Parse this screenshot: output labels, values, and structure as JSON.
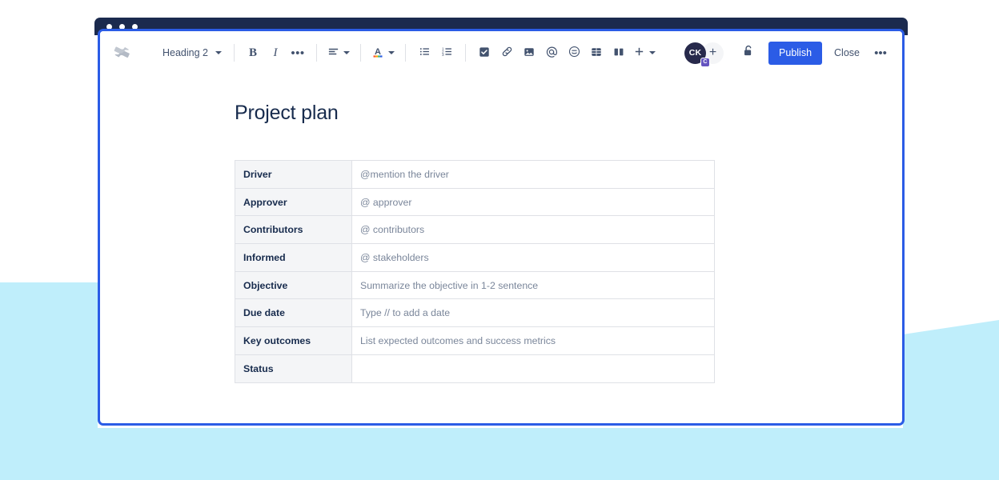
{
  "window": {
    "traffic_lights": [
      "dot-1",
      "dot-2",
      "dot-3"
    ]
  },
  "toolbar": {
    "app_logo_name": "confluence-logo-icon",
    "heading_select": {
      "label": "Heading 2",
      "icon": "chevron-down-icon"
    },
    "format_buttons": [
      {
        "name": "bold-button",
        "label": "B",
        "icon": "bold-icon"
      },
      {
        "name": "italic-button",
        "label": "I",
        "icon": "italic-icon"
      },
      {
        "name": "more-formatting-button",
        "label": "•••",
        "icon": "ellipsis-icon"
      }
    ],
    "align_button": {
      "name": "text-align-button",
      "icon": "align-left-icon"
    },
    "text-color_button": {
      "name": "text-color-button",
      "label": "A",
      "icon": "text-color-icon"
    },
    "list_buttons": [
      {
        "name": "bullet-list-button",
        "icon": "bullet-list-icon"
      },
      {
        "name": "numbered-list-button",
        "icon": "numbered-list-icon"
      }
    ],
    "insert_buttons": [
      {
        "name": "task-list-button",
        "icon": "checkbox-icon"
      },
      {
        "name": "link-button",
        "icon": "link-icon"
      },
      {
        "name": "image-button",
        "icon": "image-icon"
      },
      {
        "name": "mention-button",
        "icon": "mention-at-icon"
      },
      {
        "name": "emoji-button",
        "icon": "emoji-icon"
      },
      {
        "name": "table-button",
        "icon": "table-icon"
      },
      {
        "name": "layout-button",
        "icon": "layout-columns-icon"
      },
      {
        "name": "insert-more-button",
        "icon": "plus-icon"
      }
    ],
    "avatar": {
      "initials": "CK",
      "badge_label": "C",
      "badge_color": "#6554C0",
      "background_color": "#27294B"
    },
    "add_person_label": "+",
    "restrictions_icon": "unlocked-padlock-icon",
    "publish_label": "Publish",
    "publish_color": "#2B5CE6",
    "close_label": "Close",
    "more_label": "•••"
  },
  "document": {
    "title": "Project plan",
    "table": {
      "rows": [
        {
          "label": "Driver",
          "value": "@mention the driver"
        },
        {
          "label": "Approver",
          "value": "@ approver"
        },
        {
          "label": "Contributors",
          "value": "@ contributors"
        },
        {
          "label": "Informed",
          "value": "@ stakeholders"
        },
        {
          "label": "Objective",
          "value": "Summarize the objective in 1-2 sentence"
        },
        {
          "label": "Due date",
          "value": "Type // to add a date"
        },
        {
          "label": "Key outcomes",
          "value": "List expected outcomes and success metrics"
        },
        {
          "label": "Status",
          "value": ""
        }
      ]
    }
  },
  "theme": {
    "accent": "#2B5CE6",
    "background_shape": "#BFEEFB",
    "titlebar": "#1B2A4E",
    "text_primary": "#172B4D",
    "text_secondary": "#7A869A"
  }
}
